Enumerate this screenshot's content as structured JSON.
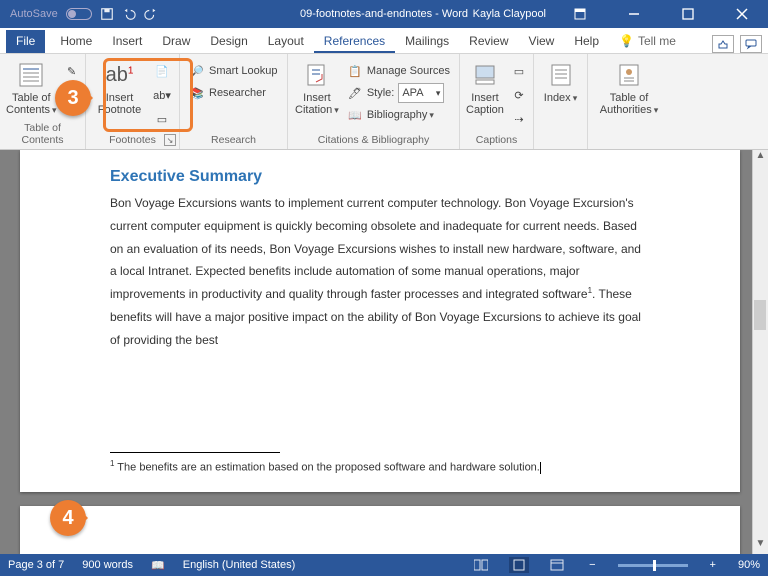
{
  "titlebar": {
    "autosave": "AutoSave",
    "doc_title": "09-footnotes-and-endnotes - Word",
    "user": "Kayla Claypool"
  },
  "tabs": {
    "file": "File",
    "home": "Home",
    "insert": "Insert",
    "draw": "Draw",
    "design": "Design",
    "layout": "Layout",
    "references": "References",
    "mailings": "Mailings",
    "review": "Review",
    "view": "View",
    "help": "Help",
    "tellme": "Tell me"
  },
  "ribbon": {
    "toc": {
      "button": "Table of\nContents",
      "group": "Table of Contents"
    },
    "footnotes": {
      "button": "Insert\nFootnote",
      "group": "Footnotes"
    },
    "research": {
      "smart": "Smart Lookup",
      "researcher": "Researcher",
      "group": "Research"
    },
    "citations": {
      "insert": "Insert\nCitation",
      "manage": "Manage Sources",
      "style_label": "Style:",
      "style_value": "APA",
      "biblio": "Bibliography",
      "group": "Citations & Bibliography"
    },
    "captions": {
      "button": "Insert\nCaption",
      "group": "Captions"
    },
    "index": {
      "button": "Index",
      "group": ""
    },
    "toa": {
      "button": "Table of\nAuthorities",
      "group": ""
    }
  },
  "callouts": {
    "c3": "3",
    "c4": "4"
  },
  "document": {
    "heading": "Executive Summary",
    "para": "Bon Voyage Excursions wants to implement current computer technology. Bon Voyage Excursion's current computer equipment is quickly becoming obsolete and inadequate for current needs. Based on an evaluation of its needs, Bon Voyage Excursions wishes to install new hardware, software, and a local Intranet. Expected benefits include automation of some manual operations, major improvements in productivity and quality through faster processes and integrated software",
    "para_tail": ". These benefits will have a major positive impact on the ability of Bon Voyage Excursions to achieve its goal of providing the best",
    "footnote_ref": "1",
    "footnote_num": "1",
    "footnote_text": " The benefits are an estimation based on the proposed software and hardware solution."
  },
  "status": {
    "page": "Page 3 of 7",
    "words": "900 words",
    "lang": "English (United States)",
    "zoom": "90%"
  }
}
